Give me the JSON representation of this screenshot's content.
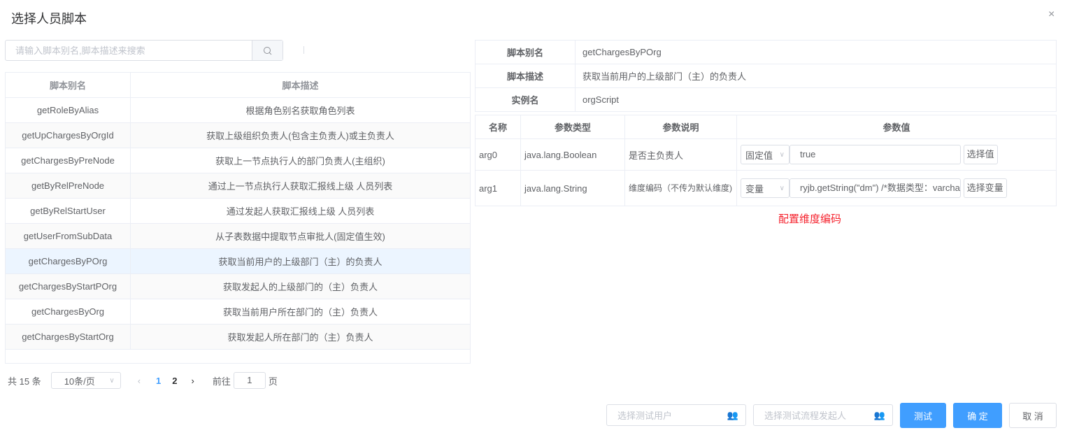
{
  "dialog": {
    "title": "选择人员脚本",
    "close": "×"
  },
  "search": {
    "placeholder": "请输入脚本别名,脚本描述来搜索"
  },
  "list": {
    "headers": [
      "脚本别名",
      "脚本描述"
    ],
    "rows": [
      [
        "getRoleByAlias",
        "根据角色别名获取角色列表"
      ],
      [
        "getUpChargesByOrgId",
        "获取上级组织负责人(包含主负责人)或主负责人"
      ],
      [
        "getChargesByPreNode",
        "获取上一节点执行人的部门负责人(主组织)"
      ],
      [
        "getByRelPreNode",
        "通过上一节点执行人获取汇报线上级 人员列表"
      ],
      [
        "getByRelStartUser",
        "通过发起人获取汇报线上级 人员列表"
      ],
      [
        "getUserFromSubData",
        "从子表数据中提取节点审批人(固定值生效)"
      ],
      [
        "getChargesByPOrg",
        "获取当前用户的上级部门（主）的负责人"
      ],
      [
        "getChargesByStartPOrg",
        "获取发起人的上级部门的（主）负责人"
      ],
      [
        "getChargesByOrg",
        "获取当前用户所在部门的（主）负责人"
      ],
      [
        "getChargesByStartOrg",
        "获取发起人所在部门的（主）负责人"
      ]
    ]
  },
  "pagination": {
    "total": "共 15 条",
    "page_size": "10条/页",
    "pages": [
      "1",
      "2"
    ],
    "current": "1",
    "goto_label": "前往",
    "goto_value": "1",
    "page_suffix": "页"
  },
  "info": [
    {
      "label": "脚本别名",
      "value": "getChargesByPOrg"
    },
    {
      "label": "脚本描述",
      "value": "获取当前用户的上级部门（主）的负责人"
    },
    {
      "label": "实例名",
      "value": "orgScript"
    }
  ],
  "params": {
    "headers": [
      "名称",
      "参数类型",
      "参数说明",
      "参数值"
    ],
    "rows": [
      {
        "name": "arg0",
        "type": "java.lang.Boolean",
        "desc": "是否主负责人",
        "mode": "固定值",
        "value": "true",
        "button": "选择值"
      },
      {
        "name": "arg1",
        "type": "java.lang.String",
        "desc": "维度编码（不传为默认维度)",
        "mode": "变量",
        "value": "ryjb.getString(\"dm\") /*数据类型：varchar",
        "button": "选择变量"
      }
    ]
  },
  "hint": "配置维度编码",
  "footer": {
    "test_user_placeholder": "选择测试用户",
    "test_starter_placeholder": "选择测试流程发起人",
    "test": "测试",
    "confirm": "确 定",
    "cancel": "取 消"
  },
  "colors": {
    "primary": "#409eff",
    "hint": "#f5222d",
    "selected_row": "#ecf5ff"
  }
}
